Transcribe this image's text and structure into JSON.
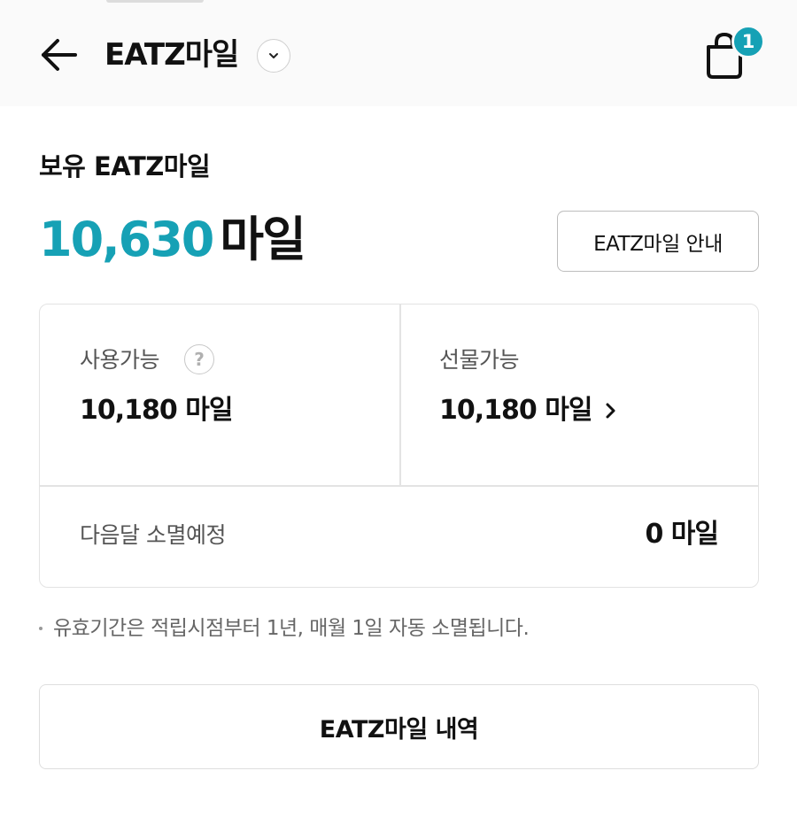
{
  "header": {
    "title": "EATZ마일",
    "back_icon": "arrow-left-icon",
    "dropdown_icon": "chevron-down-icon",
    "cart_icon": "shopping-bag-icon",
    "cart_count": "1",
    "accent_color": "#16a1b5"
  },
  "balance": {
    "label": "보유 EATZ마일",
    "amount": "10,630",
    "unit": "마일",
    "guide_button": "EATZ마일 안내"
  },
  "card": {
    "available": {
      "label": "사용가능",
      "help_icon": "question-circle-icon",
      "help_glyph": "?",
      "value": "10,180",
      "unit": "마일"
    },
    "giftable": {
      "label": "선물가능",
      "value": "10,180",
      "unit": "마일",
      "arrow_icon": "chevron-right-icon"
    },
    "expiring": {
      "label": "다음달 소멸예정",
      "value": "0",
      "unit": "마일"
    }
  },
  "notice": "유효기간은 적립시점부터 1년, 매월 1일 자동 소멸됩니다.",
  "history_button": "EATZ마일 내역"
}
